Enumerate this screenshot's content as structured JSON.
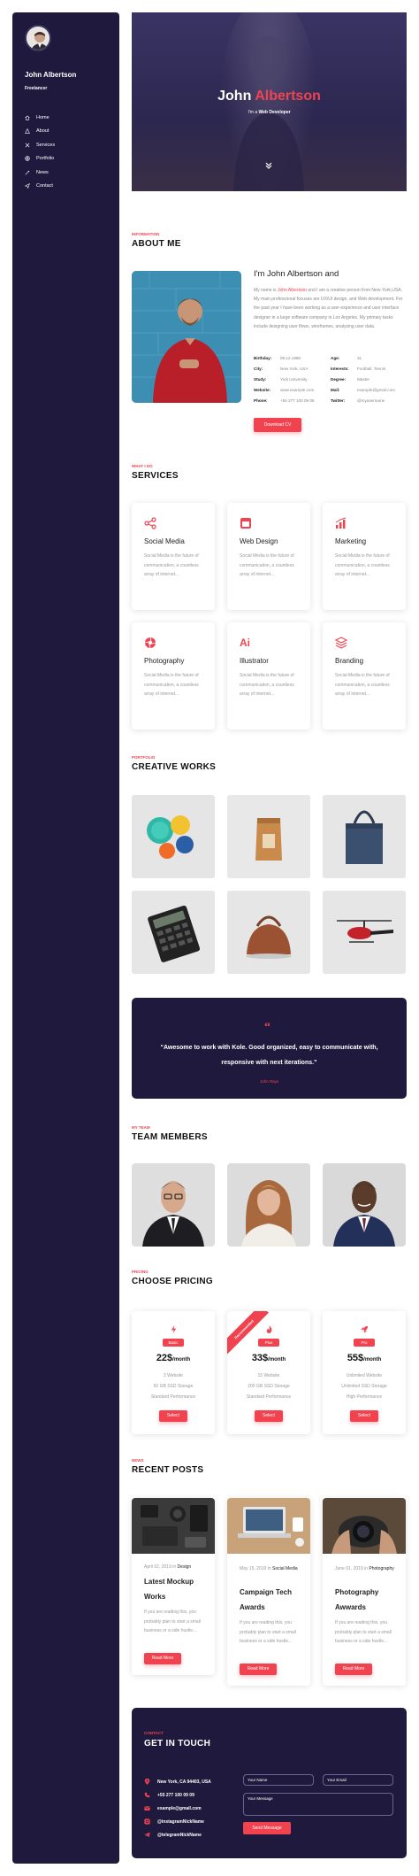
{
  "sidebar": {
    "name": "John Albertson",
    "role": "Freelancer",
    "nav": [
      {
        "label": "Home",
        "icon": "home-icon"
      },
      {
        "label": "About",
        "icon": "user-icon"
      },
      {
        "label": "Services",
        "icon": "tools-icon"
      },
      {
        "label": "Portfolio",
        "icon": "globe-icon"
      },
      {
        "label": "News",
        "icon": "pen-icon"
      },
      {
        "label": "Contact",
        "icon": "send-icon"
      }
    ]
  },
  "hero": {
    "first": "John",
    "last": "Albertson",
    "sub_prefix": "I'm a",
    "sub_role": "Web Developer"
  },
  "about": {
    "eyebrow": "INFORMATION",
    "title": "ABOUT ME",
    "heading": "I'm John Albertson and",
    "p_before": "My name is ",
    "p_highlight": "John Albertson",
    "p_after": " and I am a creative person from New-York,USA. My main professional focuses are UX/UI design, and Web development. For the past year I have been working as a user experience and user interface designer in a large software company in Los Angeles. My primary tasks include designing user flows, wireframes, analyzing user data.",
    "info_left": [
      {
        "k": "Birthday:",
        "v": "09.12.1988"
      },
      {
        "k": "City:",
        "v": "New York, USA"
      },
      {
        "k": "Study:",
        "v": "York University"
      },
      {
        "k": "Website:",
        "v": "www.example.com"
      },
      {
        "k": "Phone:",
        "v": "+55 277 100 09 09"
      }
    ],
    "info_right": [
      {
        "k": "Age:",
        "v": "31"
      },
      {
        "k": "Interests:",
        "v": "Football, Tennis"
      },
      {
        "k": "Degree:",
        "v": "Master"
      },
      {
        "k": "Mail:",
        "v": "example@gmail.com"
      },
      {
        "k": "Twitter:",
        "v": "@myusername"
      }
    ],
    "download": "Download CV"
  },
  "services": {
    "eyebrow": "WHAT I DO",
    "title": "SERVICES",
    "items": [
      {
        "title": "Social Media",
        "icon": "share-icon",
        "desc": "Social Media is the future of communication, a countless array of internet..."
      },
      {
        "title": "Web Design",
        "icon": "browser-icon",
        "desc": "Social Media is the future of communication, a countless array of internet..."
      },
      {
        "title": "Marketing",
        "icon": "chart-icon",
        "desc": "Social Media is the future of communication, a countless array of internet..."
      },
      {
        "title": "Photography",
        "icon": "aperture-icon",
        "desc": "Social Media is the future of communication, a countless array of internet..."
      },
      {
        "title": "Illustrator",
        "icon": "illustrator-icon",
        "icon_text": "Ai",
        "desc": "Social Media is the future of communication, a countless array of internet..."
      },
      {
        "title": "Branding",
        "icon": "layers-icon",
        "desc": "Social Media is the future of communication, a countless array of internet..."
      }
    ]
  },
  "portfolio": {
    "eyebrow": "PORTFOLIO",
    "title": "CREATIVE WORKS",
    "items": [
      "color-bowls-image",
      "coffee-bag-image",
      "tote-bag-image",
      "calculator-image",
      "handbag-image",
      "helicopter-image"
    ]
  },
  "quote": {
    "mark": "“",
    "text": "“Awesome to work with Kole. Good organized, easy to communicate with, responsive with next iterations.”",
    "author": "John Rays"
  },
  "team": {
    "eyebrow": "MY TEAM",
    "title": "TEAM MEMBERS"
  },
  "pricing": {
    "eyebrow": "PRICING",
    "title": "CHOOSE PRICING",
    "ribbon": "Recommended",
    "plans": [
      {
        "badge": "Basic",
        "icon": "bolt-icon",
        "price": "22$",
        "per": "/month",
        "lines": [
          "3 Website",
          "50 GB SSD Storage",
          "Standard Performance"
        ],
        "button": "Select"
      },
      {
        "badge": "Plus",
        "icon": "fire-icon",
        "price": "33$",
        "per": "/month",
        "lines": [
          "15 Website",
          "200 GB SSD Storage",
          "Standard Performance"
        ],
        "button": "Select"
      },
      {
        "badge": "Pro",
        "icon": "rocket-icon",
        "price": "55$",
        "per": "/month",
        "lines": [
          "Unlimited Website",
          "Unlimited SSD Storage",
          "High Performance"
        ],
        "button": "Select"
      }
    ]
  },
  "news": {
    "eyebrow": "NEWS",
    "title": "RECENT POSTS",
    "posts": [
      {
        "date": "April 02, 2019",
        "in": "in",
        "cat": "Design",
        "title": "Latest Mockup Works",
        "excerpt": "If you are reading this, you probably plan to start a small business or a side hustle...",
        "button": "Read More"
      },
      {
        "date": "May 15, 2019",
        "in": "in",
        "cat": "Social Media",
        "title": "Campaign Tech Awards",
        "excerpt": "If you are reading this, you probably plan to start a small business or a side hustle...",
        "button": "Read More"
      },
      {
        "date": "June 01, 2019",
        "in": "in",
        "cat": "Photography",
        "title": "Photography Awwards",
        "excerpt": "If you are reading this, you probably plan to start a small business or a side hustle...",
        "button": "Read More"
      }
    ]
  },
  "contact": {
    "eyebrow": "CONTACT",
    "title": "GET IN TOUCH",
    "rows": [
      {
        "icon": "location-icon",
        "text": "New York, CA 94403, USA"
      },
      {
        "icon": "phone-icon",
        "text": "+55 277 100 09 09"
      },
      {
        "icon": "mail-icon",
        "text": "example@gmail.com"
      },
      {
        "icon": "instagram-icon",
        "text": "@instagramNickName"
      },
      {
        "icon": "telegram-icon",
        "text": "@telegramNickName"
      }
    ],
    "name_ph": "Your Name",
    "email_ph": "Your Email",
    "message_ph": "Your Message",
    "send": "Send Message"
  },
  "colors": {
    "accent": "#f0434f",
    "navy": "#1f1a3d"
  }
}
